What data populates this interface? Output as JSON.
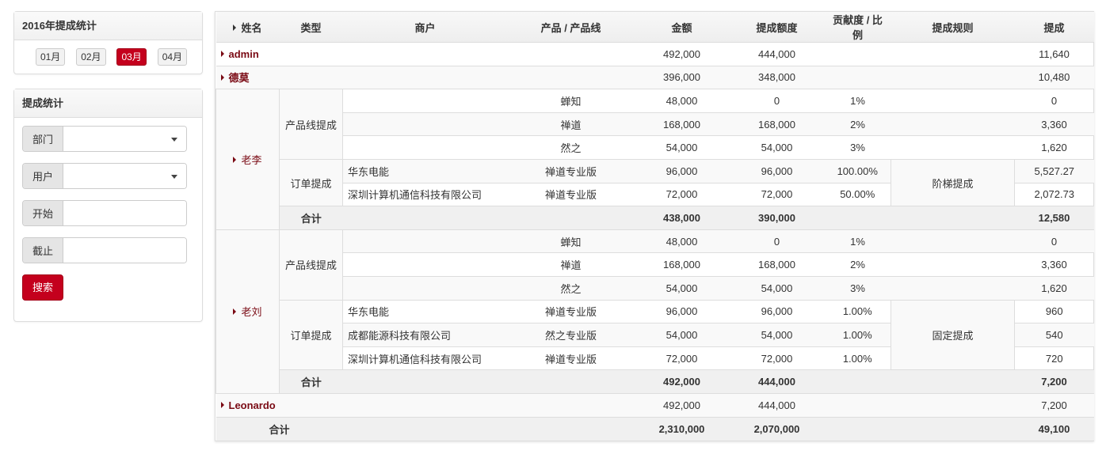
{
  "month_panel": {
    "title": "2016年提成统计",
    "months": [
      {
        "label": "01月",
        "active": false
      },
      {
        "label": "02月",
        "active": false
      },
      {
        "label": "03月",
        "active": true
      },
      {
        "label": "04月",
        "active": false
      }
    ]
  },
  "filter_panel": {
    "title": "提成统计",
    "fields": [
      {
        "label": "部门",
        "type": "select",
        "value": ""
      },
      {
        "label": "用户",
        "type": "select",
        "value": ""
      },
      {
        "label": "开始",
        "type": "text",
        "value": ""
      },
      {
        "label": "截止",
        "type": "text",
        "value": ""
      }
    ],
    "search_label": "搜索"
  },
  "table": {
    "headers": [
      "姓名",
      "类型",
      "商户",
      "产品 / 产品线",
      "金额",
      "提成额度",
      "贡献度 / 比例",
      "提成规则",
      "提成"
    ],
    "rows": [
      {
        "kind": "simple",
        "name": "admin",
        "amount": "492,000",
        "quota": "444,000",
        "commission": "11,640"
      },
      {
        "kind": "simple",
        "name": "德莫",
        "amount": "396,000",
        "quota": "348,000",
        "commission": "10,480"
      },
      {
        "kind": "group",
        "name": "老李",
        "sections": [
          {
            "type": "产品线提成",
            "rule": "",
            "items": [
              {
                "merchant": "",
                "product": "蝉知",
                "amount": "48,000",
                "quota": "0",
                "ratio": "1%",
                "commission": "0"
              },
              {
                "merchant": "",
                "product": "禅道",
                "amount": "168,000",
                "quota": "168,000",
                "ratio": "2%",
                "commission": "3,360"
              },
              {
                "merchant": "",
                "product": "然之",
                "amount": "54,000",
                "quota": "54,000",
                "ratio": "3%",
                "commission": "1,620"
              }
            ]
          },
          {
            "type": "订单提成",
            "rule": "阶梯提成",
            "items": [
              {
                "merchant": "华东电能",
                "product": "禅道专业版",
                "amount": "96,000",
                "quota": "96,000",
                "ratio": "100.00%",
                "commission": "5,527.27"
              },
              {
                "merchant": "深圳计算机通信科技有限公司",
                "product": "禅道专业版",
                "amount": "72,000",
                "quota": "72,000",
                "ratio": "50.00%",
                "commission": "2,072.73"
              }
            ]
          }
        ],
        "subtotal": {
          "label": "合计",
          "amount": "438,000",
          "quota": "390,000",
          "commission": "12,580"
        }
      },
      {
        "kind": "group",
        "name": "老刘",
        "sections": [
          {
            "type": "产品线提成",
            "rule": "",
            "items": [
              {
                "merchant": "",
                "product": "蝉知",
                "amount": "48,000",
                "quota": "0",
                "ratio": "1%",
                "commission": "0"
              },
              {
                "merchant": "",
                "product": "禅道",
                "amount": "168,000",
                "quota": "168,000",
                "ratio": "2%",
                "commission": "3,360"
              },
              {
                "merchant": "",
                "product": "然之",
                "amount": "54,000",
                "quota": "54,000",
                "ratio": "3%",
                "commission": "1,620"
              }
            ]
          },
          {
            "type": "订单提成",
            "rule": "固定提成",
            "items": [
              {
                "merchant": "华东电能",
                "product": "禅道专业版",
                "amount": "96,000",
                "quota": "96,000",
                "ratio": "1.00%",
                "commission": "960"
              },
              {
                "merchant": "成都能源科技有限公司",
                "product": "然之专业版",
                "amount": "54,000",
                "quota": "54,000",
                "ratio": "1.00%",
                "commission": "540"
              },
              {
                "merchant": "深圳计算机通信科技有限公司",
                "product": "禅道专业版",
                "amount": "72,000",
                "quota": "72,000",
                "ratio": "1.00%",
                "commission": "720"
              }
            ]
          }
        ],
        "subtotal": {
          "label": "合计",
          "amount": "492,000",
          "quota": "444,000",
          "commission": "7,200"
        }
      },
      {
        "kind": "simple",
        "name": "Leonardo",
        "amount": "492,000",
        "quota": "444,000",
        "commission": "7,200"
      }
    ],
    "total": {
      "label": "合计",
      "amount": "2,310,000",
      "quota": "2,070,000",
      "commission": "49,100"
    }
  }
}
